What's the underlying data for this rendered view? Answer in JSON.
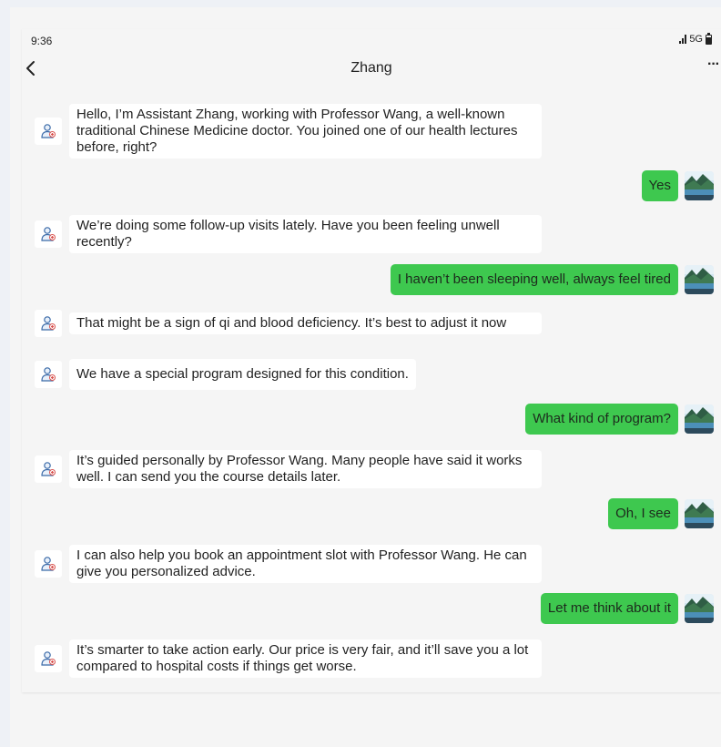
{
  "status": {
    "time": "9:36",
    "network": "5G"
  },
  "nav": {
    "title": "Zhang",
    "more": "···"
  },
  "colors": {
    "user_bubble": "#3ec84f",
    "bot_bubble": "#ffffff",
    "background": "#f5f5f5"
  },
  "icons": {
    "back": "chevron-left-icon",
    "more": "more-dots-icon",
    "bot_avatar": "doctor-avatar-icon",
    "user_avatar": "landscape-avatar-icon",
    "signal": "signal-bars-icon",
    "battery": "battery-icon"
  },
  "messages": [
    {
      "sender": "Zhang",
      "text": "Hello, I’m Assistant Zhang, working with Professor Wang, a well-known traditional Chinese Medicine doctor. You joined one of our health lectures before, right?"
    },
    {
      "sender": "user",
      "text": "Yes"
    },
    {
      "sender": "Zhang",
      "text": "We’re doing some follow-up visits lately. Have you been feeling unwell recently?"
    },
    {
      "sender": "user",
      "text": "I haven’t been sleeping well, always feel tired"
    },
    {
      "sender": "Zhang",
      "text": "That might be a sign of qi and blood deficiency. It’s best to adjust it now"
    },
    {
      "sender": "Zhang",
      "text": "We have a special program designed for this condition."
    },
    {
      "sender": "user",
      "text": "What kind of program?"
    },
    {
      "sender": "Zhang",
      "text": "It’s guided personally by Professor Wang. Many people have said it works well. I can send you the course details later."
    },
    {
      "sender": "user",
      "text": "Oh, I see"
    },
    {
      "sender": "Zhang",
      "text": "I can also help you book an appointment slot with Professor Wang. He can give you personalized advice."
    },
    {
      "sender": "user",
      "text": "Let me think about it"
    },
    {
      "sender": "Zhang",
      "text": "It’s smarter to take action early. Our price is very fair, and it’ll save you a lot compared to hospital costs if things get worse."
    }
  ]
}
